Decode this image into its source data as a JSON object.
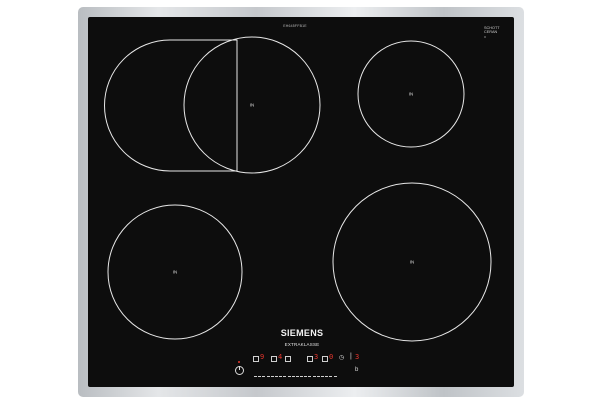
{
  "product": {
    "brand": "SIEMENS",
    "line": "EXTRAKLASSE",
    "top_code": "EH645FFB1E",
    "badge_line1": "SCHOTT",
    "badge_line2": "CERAN",
    "badge_code": "R",
    "zone_label": "IN"
  },
  "controls": {
    "left_digit": "9",
    "center_left_digit": "4",
    "mid_left_digit": "3",
    "mid_right_digit": "0",
    "right_digit": "3",
    "right_bracket": "|",
    "slider_end": "b"
  },
  "colors": {
    "glass": "#0d0d0d",
    "frame": "#c9ccd0",
    "zone_outline": "#e8e8e8",
    "display_red": "#e8362e"
  }
}
